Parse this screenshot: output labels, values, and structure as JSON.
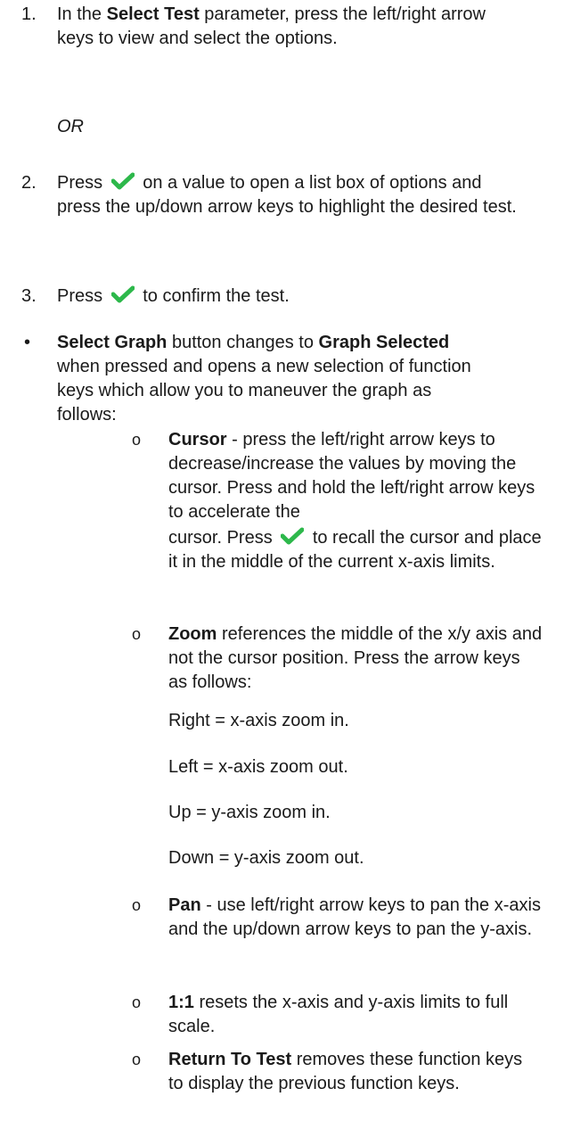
{
  "steps": [
    {
      "num": "1.",
      "pre": "In the ",
      "bold": "Select Test",
      "post": " parameter, press the left/right arrow keys to view and select the options."
    },
    {
      "or": "OR"
    },
    {
      "num": "2.",
      "pre": "Press ",
      "post": " on a value to open a list box of options and press the up/down arrow keys to highlight the desired test."
    },
    {
      "num": "3.",
      "pre": "Press ",
      "post": " to confirm the test."
    }
  ],
  "bullet": {
    "symbol": "•",
    "bold1": "Select Graph",
    "mid": " button changes to ",
    "bold2": "Graph Selected",
    "post": " when pressed and opens a new selection of function keys which allow you to maneuver the graph as follows:"
  },
  "sub_items": {
    "symbol": "o",
    "cursor": {
      "bold": "Cursor",
      "text1": " - press the left/right arrow keys to decrease/increase the values by moving the cursor. Press and hold the left/right arrow keys to accelerate the",
      "text2a": "cursor. Press ",
      "text2b": " to recall the cursor and place it in the middle of the current x-axis limits."
    },
    "zoom": {
      "bold": "Zoom",
      "text": " references the middle of the x/y axis and not the cursor position. Press the arrow keys as follows:"
    },
    "zoom_lines": [
      "Right = x-axis zoom in.",
      "Left = x-axis zoom out.",
      "Up = y-axis zoom in.",
      "Down = y-axis zoom out."
    ],
    "pan": {
      "bold": "Pan",
      "text": " - use left/right arrow keys to pan the x-axis and the up/down arrow keys to pan the y-axis."
    },
    "one_to_one": {
      "bold": "1:1",
      "text": " resets the x-axis and y-axis limits to full scale."
    },
    "return": {
      "bold": "Return To Test",
      "text": " removes these function keys to display the previous function keys."
    }
  },
  "colors": {
    "check": "#2db84b",
    "text": "#1a1a1a"
  },
  "icons": {
    "check": "check-icon"
  }
}
